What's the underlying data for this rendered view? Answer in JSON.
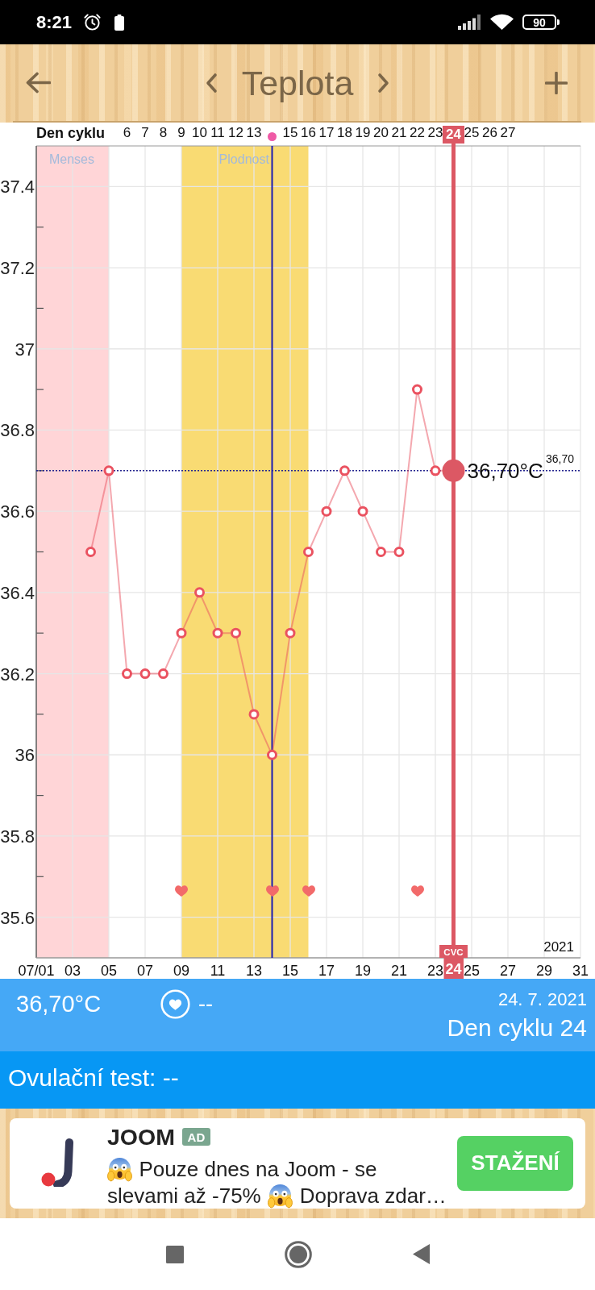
{
  "status_bar": {
    "time": "8:21",
    "battery": "90"
  },
  "header": {
    "title": "Teplota"
  },
  "chart": {
    "cycle_axis": {
      "label": "Den cyklu",
      "days": [
        {
          "kind": "day",
          "label": "6",
          "intercourse": false
        },
        {
          "kind": "day",
          "label": "7",
          "intercourse": false
        },
        {
          "kind": "day",
          "label": "8",
          "intercourse": false
        },
        {
          "kind": "day",
          "label": "9",
          "intercourse": true
        },
        {
          "kind": "day",
          "label": "10",
          "intercourse": false
        },
        {
          "kind": "day",
          "label": "11",
          "intercourse": false
        },
        {
          "kind": "day",
          "label": "12",
          "intercourse": false
        },
        {
          "kind": "day",
          "label": "13",
          "intercourse": false
        },
        {
          "kind": "ovulation",
          "intercourse": true
        },
        {
          "kind": "day",
          "label": "15",
          "intercourse": false
        },
        {
          "kind": "day",
          "label": "16",
          "intercourse": true
        },
        {
          "kind": "day",
          "label": "17",
          "intercourse": false
        },
        {
          "kind": "day",
          "label": "18",
          "intercourse": false
        },
        {
          "kind": "day",
          "label": "19",
          "intercourse": false
        },
        {
          "kind": "day",
          "label": "20",
          "intercourse": false
        },
        {
          "kind": "day",
          "label": "21",
          "intercourse": false
        },
        {
          "kind": "day",
          "label": "22",
          "intercourse": true
        },
        {
          "kind": "day",
          "label": "23",
          "intercourse": false
        },
        {
          "kind": "today",
          "label": "24",
          "intercourse": false
        },
        {
          "kind": "day",
          "label": "25",
          "intercourse": false
        },
        {
          "kind": "day",
          "label": "26",
          "intercourse": false
        },
        {
          "kind": "day",
          "label": "27",
          "intercourse": false
        }
      ]
    },
    "current_value": "36,70°C",
    "year": "2021",
    "chart_data": {
      "type": "line",
      "x": [
        4,
        5,
        6,
        7,
        8,
        9,
        10,
        11,
        12,
        13,
        14,
        15,
        16,
        17,
        18,
        19,
        20,
        21,
        22,
        23,
        24
      ],
      "series": [
        {
          "color": "#ea5260",
          "marker": "circle",
          "values": [
            36.5,
            36.7,
            36.2,
            36.2,
            36.2,
            36.3,
            36.4,
            36.3,
            36.3,
            36.1,
            36.0,
            36.3,
            36.5,
            36.6,
            36.7,
            36.6,
            36.5,
            36.5,
            36.9,
            36.7,
            36.7
          ]
        }
      ],
      "xlim": [
        1,
        31
      ],
      "ylim": [
        35.5,
        37.5
      ],
      "xticks": [
        {
          "value": 1,
          "label": "07/01"
        },
        {
          "value": 3,
          "label": "03"
        },
        {
          "value": 5,
          "label": "05"
        },
        {
          "value": 7,
          "label": "07"
        },
        {
          "value": 9,
          "label": "09"
        },
        {
          "value": 11,
          "label": "11"
        },
        {
          "value": 13,
          "label": "13"
        },
        {
          "value": 15,
          "label": "15"
        },
        {
          "value": 17,
          "label": "17"
        },
        {
          "value": 19,
          "label": "19"
        },
        {
          "value": 21,
          "label": "21"
        },
        {
          "value": 23,
          "label": "23"
        },
        {
          "value": 24,
          "label": "24"
        },
        {
          "value": 25,
          "label": "25"
        },
        {
          "value": 27,
          "label": "27"
        },
        {
          "value": 29,
          "label": "29"
        },
        {
          "value": 31,
          "label": "31"
        }
      ],
      "yticks": [
        35.6,
        35.8,
        36,
        36.2,
        36.4,
        36.6,
        36.8,
        37,
        37.2,
        37.4
      ],
      "grid": true,
      "bands": [
        {
          "axis": "x",
          "from": 1,
          "to": 5,
          "label": "Menses",
          "color": "#ffd5d7"
        },
        {
          "axis": "x",
          "from": 9,
          "to": 16,
          "label": "Plodnost",
          "color": "#f9db73"
        }
      ],
      "ref_lines": [
        {
          "axis": "y",
          "value": 36.7,
          "label": "36,70",
          "color": "#25258f"
        },
        {
          "axis": "x",
          "value": 14,
          "color": "#1c1cb2"
        },
        {
          "axis": "x",
          "value": 24,
          "label": "CVC",
          "color": "#dc5864"
        }
      ]
    }
  },
  "summary": {
    "temperature": "36,70°C",
    "intercourse": "--",
    "date": "24. 7. 2021",
    "cycle_day": "Den cyklu 24"
  },
  "ovulation_test": {
    "text": "Ovulační test: --"
  },
  "ad": {
    "brand": "JOOM",
    "badge": "AD",
    "message_lines": [
      [
        {
          "kind": "emoji"
        },
        {
          "kind": "text",
          "text": "Pouze dnes na Joom - se"
        }
      ],
      [
        {
          "kind": "text",
          "text": "slevami až -75%"
        },
        {
          "kind": "emoji"
        },
        {
          "kind": "text",
          "text": "Doprava zdar…"
        }
      ]
    ],
    "button": "STAŽENÍ"
  }
}
